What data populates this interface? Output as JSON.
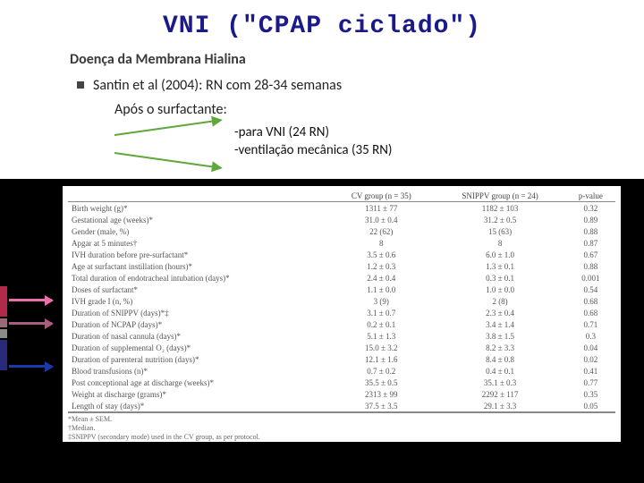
{
  "title": "VNI (\"CPAP ciclado\")",
  "subtitle": "Doença da Membrana Hialina",
  "bullet": "Santin et al (2004): RN com 28-34 semanas",
  "sub_line": "Após o surfactante:",
  "arrow_labels": {
    "line1": "-para VNI (24 RN)",
    "line2": "-ventilação mecânica (35 RN)"
  },
  "table": {
    "headers": [
      "",
      "CV group (n = 35)",
      "SNIPPV group (n = 24)",
      "p-value"
    ],
    "rows": [
      [
        "Birth weight (g)*",
        "1311 ± 77",
        "1182 ± 103",
        "0.32"
      ],
      [
        "Gestational age (weeks)*",
        "31.0 ± 0.4",
        "31.2 ± 0.5",
        "0.89"
      ],
      [
        "Gender (male, %)",
        "22 (62)",
        "15 (63)",
        "0.88"
      ],
      [
        "Apgar at 5 minutes†",
        "8",
        "8",
        "0.87"
      ],
      [
        "IVH duration before pre-surfactant*",
        "3.5 ± 0.6",
        "6.0 ± 1.0",
        "0.67"
      ],
      [
        "Age at surfactant instillation (hours)*",
        "1.2 ± 0.3",
        "1.3 ± 0.1",
        "0.88"
      ],
      [
        "Total duration of endotracheal intubation (days)*",
        "2.4 ± 0.4",
        "0.3 ± 0.1",
        "0.001"
      ],
      [
        "Doses of surfactant*",
        "1.1 ± 0.0",
        "1.0 ± 0.0",
        "0.54"
      ],
      [
        "IVH grade I (n, %)",
        "3 (9)",
        "2 (8)",
        "0.68"
      ],
      [
        "Duration of SNIPPV (days)*‡",
        "3.1 ± 0.7",
        "2.3 ± 0.4",
        "0.68"
      ],
      [
        "Duration of NCPAP (days)*",
        "0.2 ± 0.1",
        "3.4 ± 1.4",
        "0.71"
      ],
      [
        "Duration of nasal cannula (days)*",
        "5.1 ± 1.3",
        "3.8 ± 1.5",
        "0.3"
      ],
      [
        "Duration of supplemental O₂ (days)*",
        "15.0 ± 3.2",
        "8.2 ± 3.3",
        "0.04"
      ],
      [
        "Duration of parenteral nutrition (days)*",
        "12.1 ± 1.6",
        "8.4 ± 0.8",
        "0.02"
      ],
      [
        "Blood transfusions (n)*",
        "0.7 ± 0.2",
        "0.4 ± 0.1",
        "0.41"
      ],
      [
        "Post conceptional age at discharge (weeks)*",
        "35.5 ± 0.5",
        "35.1 ± 0.3",
        "0.77"
      ],
      [
        "Weight at discharge (grams)*",
        "2313 ± 99",
        "2292 ± 117",
        "0.35"
      ],
      [
        "Length of stay (days)*",
        "37.5 ± 3.5",
        "29.1 ± 3.3",
        "0.05"
      ]
    ],
    "footnotes": [
      "*Mean ± SEM.",
      "†Median.",
      "‡SNIPPV (secondary mode) used in the CV group, as per protocol."
    ]
  }
}
